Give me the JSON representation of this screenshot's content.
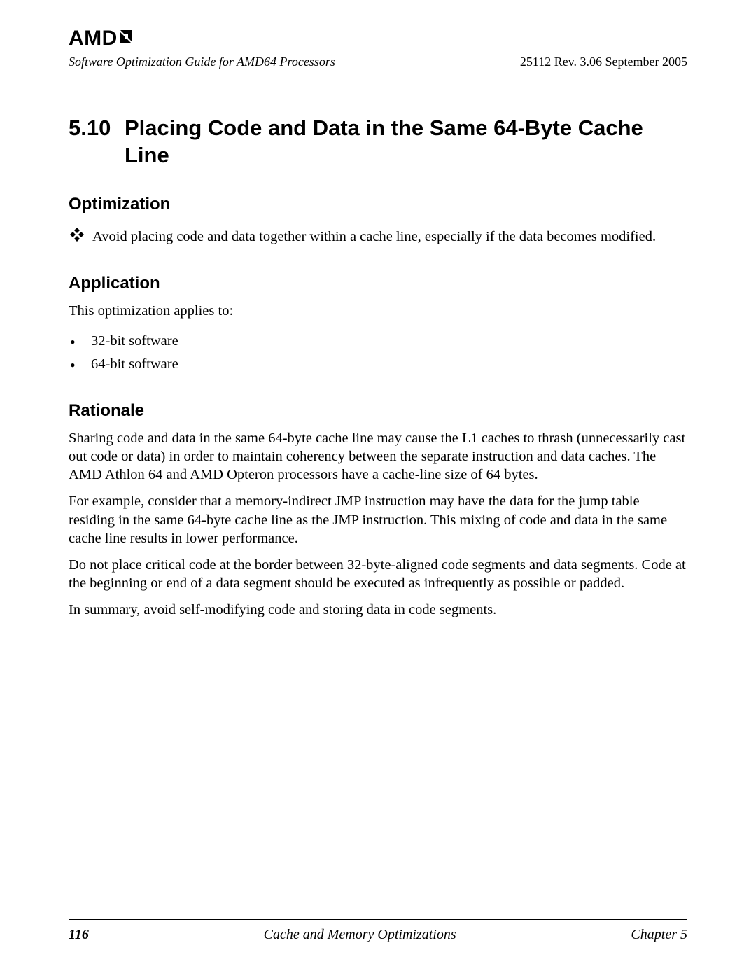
{
  "logo": {
    "text": "AMD"
  },
  "header": {
    "doc_title": "Software Optimization Guide for AMD64 Processors",
    "doc_meta": "25112   Rev. 3.06   September 2005"
  },
  "section": {
    "number": "5.10",
    "title": "Placing Code and Data in the Same 64-Byte Cache Line"
  },
  "subsections": {
    "optimization": {
      "heading": "Optimization",
      "text": "Avoid placing code and data together within a cache line, especially if the data becomes modified."
    },
    "application": {
      "heading": "Application",
      "intro": "This optimization applies to:",
      "items": [
        "32-bit software",
        "64-bit software"
      ]
    },
    "rationale": {
      "heading": "Rationale",
      "paragraphs": [
        "Sharing code and data in the same 64-byte cache line may cause the L1 caches to thrash (unnecessarily cast out code or data) in order to maintain coherency between the separate instruction and data caches. The AMD Athlon 64 and AMD Opteron processors have a cache-line size of 64 bytes.",
        "For example, consider that a memory-indirect JMP instruction may have the data for the jump table residing in the same 64-byte cache line as the JMP instruction. This mixing of code and data in the same cache line results in lower performance.",
        "Do not place critical code at the border between 32-byte-aligned code segments and data segments. Code at the beginning or end of a data segment should be executed as infrequently as possible or padded.",
        "In summary, avoid self-modifying code and storing data in code segments."
      ]
    }
  },
  "footer": {
    "page_number": "116",
    "title": "Cache and Memory Optimizations",
    "chapter": "Chapter 5"
  }
}
